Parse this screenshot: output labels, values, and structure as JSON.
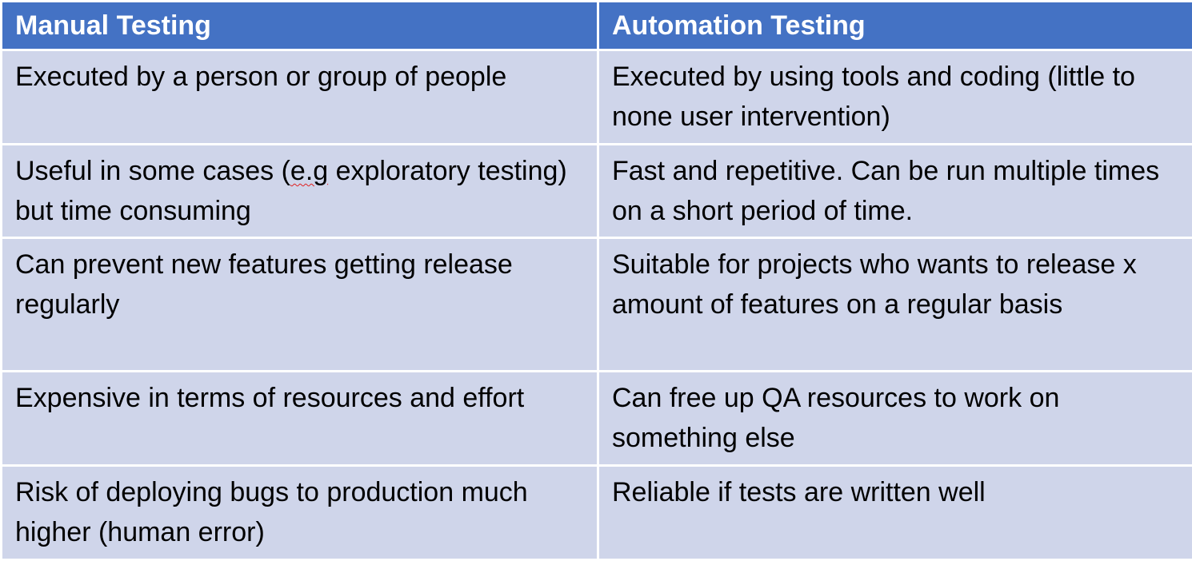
{
  "table": {
    "headers": [
      "Manual Testing",
      "Automation Testing"
    ],
    "rows": [
      {
        "manual": "Executed by a person or group of people",
        "automation": "Executed by using tools and coding (little to none user intervention)"
      },
      {
        "manual_before": "Useful in some cases (",
        "manual_flagged": "e.g",
        "manual_after": " exploratory testing) but time consuming",
        "automation": "Fast and repetitive. Can be run multiple times on a short period of time."
      },
      {
        "manual": "Can prevent new features getting release regularly",
        "automation": "Suitable for projects who wants to release x amount of features on a regular basis"
      },
      {
        "manual": "Expensive in terms of resources and effort",
        "automation": "Can free up QA resources to work on something else"
      },
      {
        "manual": "Risk of deploying bugs to production much higher (human error)",
        "automation": "Reliable if tests are written well"
      }
    ]
  },
  "colors": {
    "header_background": "#4472c4",
    "header_text": "#ffffff",
    "row_band_1": "#cfd5ea",
    "row_band_2": "#e9ebf5",
    "cell_border": "#ffffff",
    "spellcheck_underline": "#e02020"
  }
}
